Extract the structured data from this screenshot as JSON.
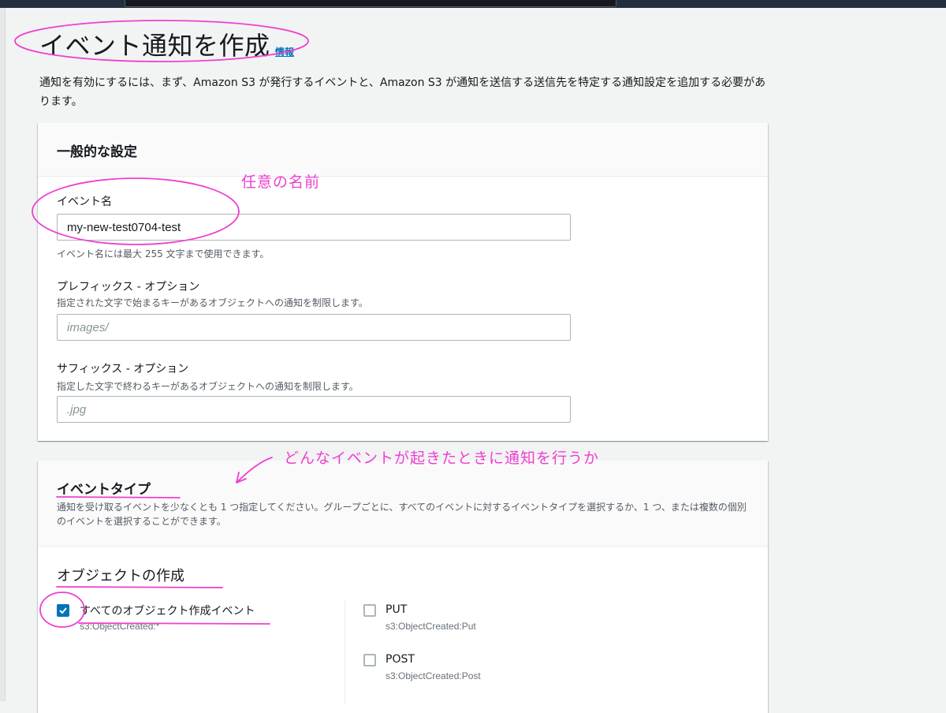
{
  "page": {
    "title": "イベント通知を作成",
    "info_link": "情報",
    "intro": "通知を有効にするには、まず、Amazon S3 が発行するイベントと、Amazon S3 が通知を送信する送信先を特定する通知設定を追加する必要があります。"
  },
  "general": {
    "heading": "一般的な設定",
    "event_name": {
      "label": "イベント名",
      "value": "my-new-test0704-test",
      "hint": "イベント名には最大 255 文字まで使用できます。"
    },
    "prefix": {
      "label": "プレフィックス - オプション",
      "desc": "指定された文字で始まるキーがあるオブジェクトへの通知を制限します。",
      "placeholder": "images/"
    },
    "suffix": {
      "label": "サフィックス - オプション",
      "desc": "指定した文字で終わるキーがあるオブジェクトへの通知を制限します。",
      "placeholder": ".jpg"
    }
  },
  "event_types": {
    "heading": "イベントタイプ",
    "desc": "通知を受け取るイベントを少なくとも 1 つ指定してください。グループごとに、すべてのイベントに対するイベントタイプを選択するか、1 つ、または複数の個別のイベントを選択することができます。",
    "group_title": "オブジェクトの作成",
    "options": [
      {
        "label": "すべてのオブジェクト作成イベント",
        "sub": "s3:ObjectCreated:*",
        "checked": true
      },
      {
        "label": "PUT",
        "sub": "s3:ObjectCreated:Put",
        "checked": false
      },
      {
        "label": "POST",
        "sub": "s3:ObjectCreated:Post",
        "checked": false
      }
    ]
  },
  "annotations": {
    "name_note": "任意の名前",
    "event_note": "どんなイベントが起きたときに通知を行うか",
    "color": "#ee3fd0"
  },
  "colors": {
    "accent": "#0073bb",
    "topbar": "#232f3e"
  }
}
